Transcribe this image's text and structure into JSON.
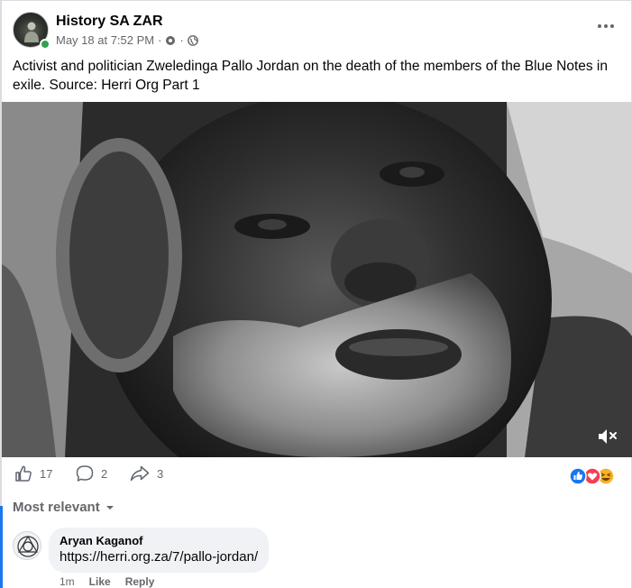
{
  "post": {
    "page_name": "History SA ZAR",
    "timestamp": "May 18 at 7:52 PM",
    "separator": "·",
    "caption": "Activist and politician Zweledinga Pallo Jordan on the death of the members of the Blue Notes in exile. Source: Herri Org Part 1",
    "icons": {
      "audience": "globe-icon",
      "settings": "gear-icon",
      "more": "more-options-icon",
      "mute": "muted-speaker-icon"
    }
  },
  "engagement": {
    "likes": "17",
    "comments": "2",
    "shares": "3",
    "reaction_types": [
      "like",
      "love",
      "haha"
    ],
    "colors": {
      "like": "#1877f2",
      "love": "#f33e58",
      "haha": "#f7b125"
    }
  },
  "comments": {
    "sort_label": "Most relevant",
    "items": [
      {
        "author": "Aryan Kaganof",
        "text": "https://herri.org.za/7/pallo-jordan/",
        "time": "1m",
        "like_label": "Like",
        "reply_label": "Reply"
      }
    ]
  }
}
